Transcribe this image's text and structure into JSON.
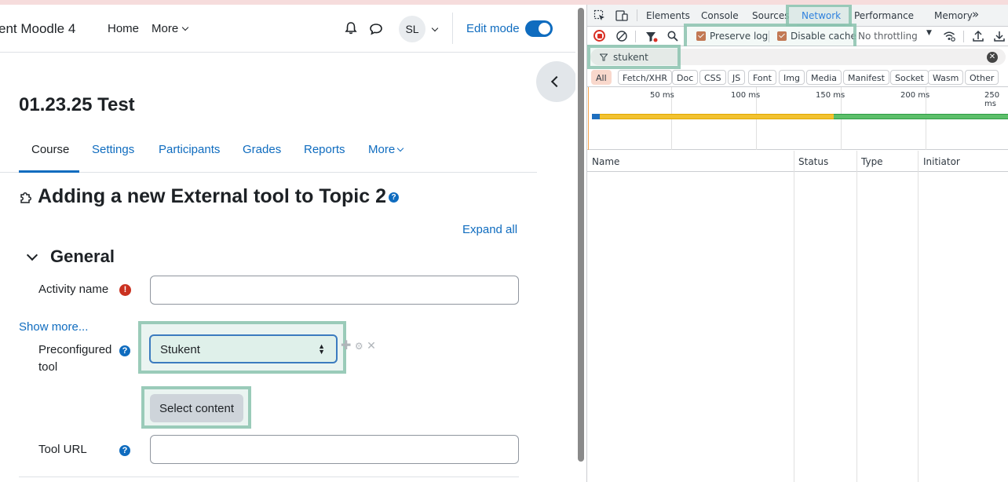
{
  "moodle": {
    "site_name": "ent Moodle 4",
    "nav": {
      "home": "Home",
      "more": "More"
    },
    "user_initials": "SL",
    "edit_mode_label": "Edit mode",
    "edit_mode_on": true,
    "course_title": "01.23.25 Test",
    "tabs": [
      {
        "label": "Course",
        "active": true
      },
      {
        "label": "Settings"
      },
      {
        "label": "Participants"
      },
      {
        "label": "Grades"
      },
      {
        "label": "Reports"
      },
      {
        "label": "More"
      }
    ],
    "page_heading": "Adding a new External tool to Topic 2",
    "expand_all": "Expand all",
    "section_title": "General",
    "form": {
      "activity_name_label": "Activity name",
      "activity_name_value": "",
      "show_more": "Show more...",
      "preconfigured_tool_label_line1": "Preconfigured",
      "preconfigured_tool_label_line2": "tool",
      "preconfigured_tool_value": "Stukent",
      "select_content_button": "Select content",
      "tool_url_label": "Tool URL",
      "tool_url_value": ""
    }
  },
  "devtools": {
    "tabs": [
      "Elements",
      "Console",
      "Sources",
      "Network",
      "Performance",
      "Memory"
    ],
    "active_tab": "Network",
    "more_tabs": "»",
    "preserve_log": {
      "label": "Preserve log",
      "checked": true
    },
    "disable_cache": {
      "label": "Disable cache",
      "checked": true
    },
    "throttling": "No throttling",
    "filter_value": "stukent",
    "type_filters": [
      "All",
      "Fetch/XHR",
      "Doc",
      "CSS",
      "JS",
      "Font",
      "Img",
      "Media",
      "Manifest",
      "Socket",
      "Wasm",
      "Other"
    ],
    "active_type_filter": "All",
    "timeline_ticks": [
      "50 ms",
      "100 ms",
      "150 ms",
      "200 ms",
      "250 ms"
    ],
    "columns": [
      "Name",
      "Status",
      "Type",
      "Initiator"
    ],
    "colors": {
      "accent": "#1a73e8",
      "highlight": "#8cc3af",
      "record": "#d93025"
    }
  }
}
